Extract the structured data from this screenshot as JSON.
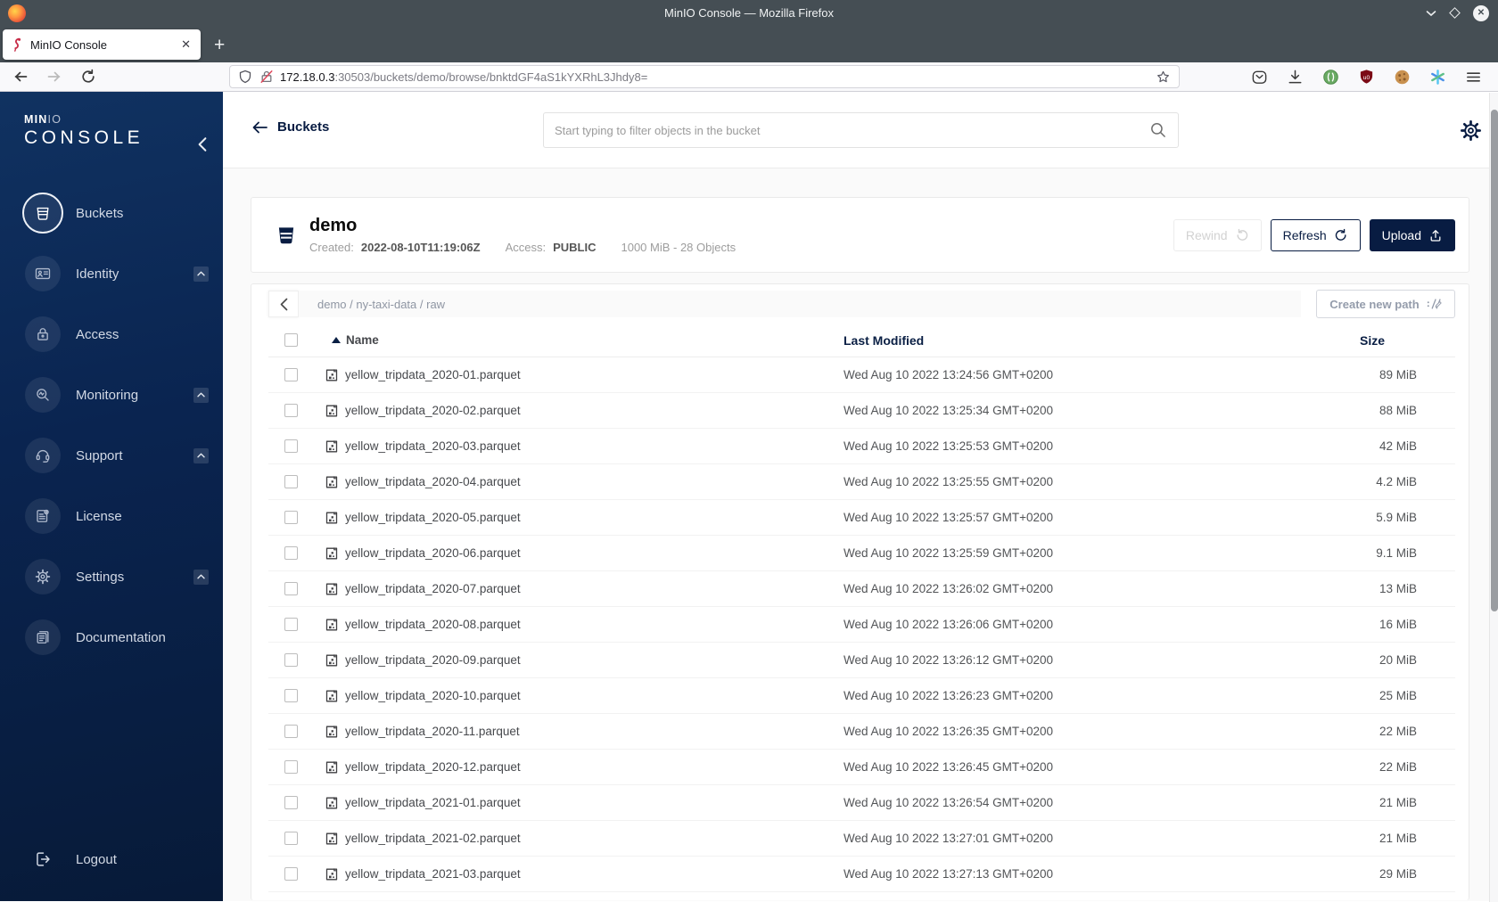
{
  "browser": {
    "window_title": "MinIO Console — Mozilla Firefox",
    "tab": {
      "title": "MinIO Console"
    },
    "url": {
      "host": "172.18.0.3",
      "rest": ":30503/buckets/demo/browse/bnktdGF4aS1kYXRhL3Jhdy8="
    }
  },
  "sidebar": {
    "logo": {
      "min": "MIN",
      "io": "IO",
      "console": "CONSOLE"
    },
    "items": [
      {
        "label": "Buckets",
        "active": true
      },
      {
        "label": "Identity",
        "expandable": true
      },
      {
        "label": "Access"
      },
      {
        "label": "Monitoring",
        "expandable": true
      },
      {
        "label": "Support",
        "expandable": true
      },
      {
        "label": "License"
      },
      {
        "label": "Settings",
        "expandable": true
      },
      {
        "label": "Documentation"
      }
    ],
    "logout": "Logout"
  },
  "header": {
    "back_label": "Buckets",
    "search_placeholder": "Start typing to filter objects in the bucket"
  },
  "bucket": {
    "name": "demo",
    "created_label": "Created:",
    "created": "2022-08-10T11:19:06Z",
    "access_label": "Access:",
    "access": "PUBLIC",
    "usage": "1000 MiB - 28 Objects",
    "buttons": {
      "rewind": "Rewind",
      "refresh": "Refresh",
      "upload": "Upload"
    }
  },
  "browse": {
    "path": "demo / ny-taxi-data / raw",
    "create_path": "Create new path"
  },
  "table": {
    "columns": {
      "name": "Name",
      "modified": "Last Modified",
      "size": "Size"
    },
    "rows": [
      {
        "name": "yellow_tripdata_2020-01.parquet",
        "modified": "Wed Aug 10 2022 13:24:56 GMT+0200",
        "size": "89 MiB"
      },
      {
        "name": "yellow_tripdata_2020-02.parquet",
        "modified": "Wed Aug 10 2022 13:25:34 GMT+0200",
        "size": "88 MiB"
      },
      {
        "name": "yellow_tripdata_2020-03.parquet",
        "modified": "Wed Aug 10 2022 13:25:53 GMT+0200",
        "size": "42 MiB"
      },
      {
        "name": "yellow_tripdata_2020-04.parquet",
        "modified": "Wed Aug 10 2022 13:25:55 GMT+0200",
        "size": "4.2 MiB"
      },
      {
        "name": "yellow_tripdata_2020-05.parquet",
        "modified": "Wed Aug 10 2022 13:25:57 GMT+0200",
        "size": "5.9 MiB"
      },
      {
        "name": "yellow_tripdata_2020-06.parquet",
        "modified": "Wed Aug 10 2022 13:25:59 GMT+0200",
        "size": "9.1 MiB"
      },
      {
        "name": "yellow_tripdata_2020-07.parquet",
        "modified": "Wed Aug 10 2022 13:26:02 GMT+0200",
        "size": "13 MiB"
      },
      {
        "name": "yellow_tripdata_2020-08.parquet",
        "modified": "Wed Aug 10 2022 13:26:06 GMT+0200",
        "size": "16 MiB"
      },
      {
        "name": "yellow_tripdata_2020-09.parquet",
        "modified": "Wed Aug 10 2022 13:26:12 GMT+0200",
        "size": "20 MiB"
      },
      {
        "name": "yellow_tripdata_2020-10.parquet",
        "modified": "Wed Aug 10 2022 13:26:23 GMT+0200",
        "size": "25 MiB"
      },
      {
        "name": "yellow_tripdata_2020-11.parquet",
        "modified": "Wed Aug 10 2022 13:26:35 GMT+0200",
        "size": "22 MiB"
      },
      {
        "name": "yellow_tripdata_2020-12.parquet",
        "modified": "Wed Aug 10 2022 13:26:45 GMT+0200",
        "size": "22 MiB"
      },
      {
        "name": "yellow_tripdata_2021-01.parquet",
        "modified": "Wed Aug 10 2022 13:26:54 GMT+0200",
        "size": "21 MiB"
      },
      {
        "name": "yellow_tripdata_2021-02.parquet",
        "modified": "Wed Aug 10 2022 13:27:01 GMT+0200",
        "size": "21 MiB"
      },
      {
        "name": "yellow_tripdata_2021-03.parquet",
        "modified": "Wed Aug 10 2022 13:27:13 GMT+0200",
        "size": "29 MiB"
      }
    ]
  },
  "colors": {
    "accent": "#081C42",
    "flamingo": "#C72C48",
    "sidebar_top": "#103261",
    "sidebar_bottom": "#071A38",
    "titlebar": "#454E54"
  }
}
